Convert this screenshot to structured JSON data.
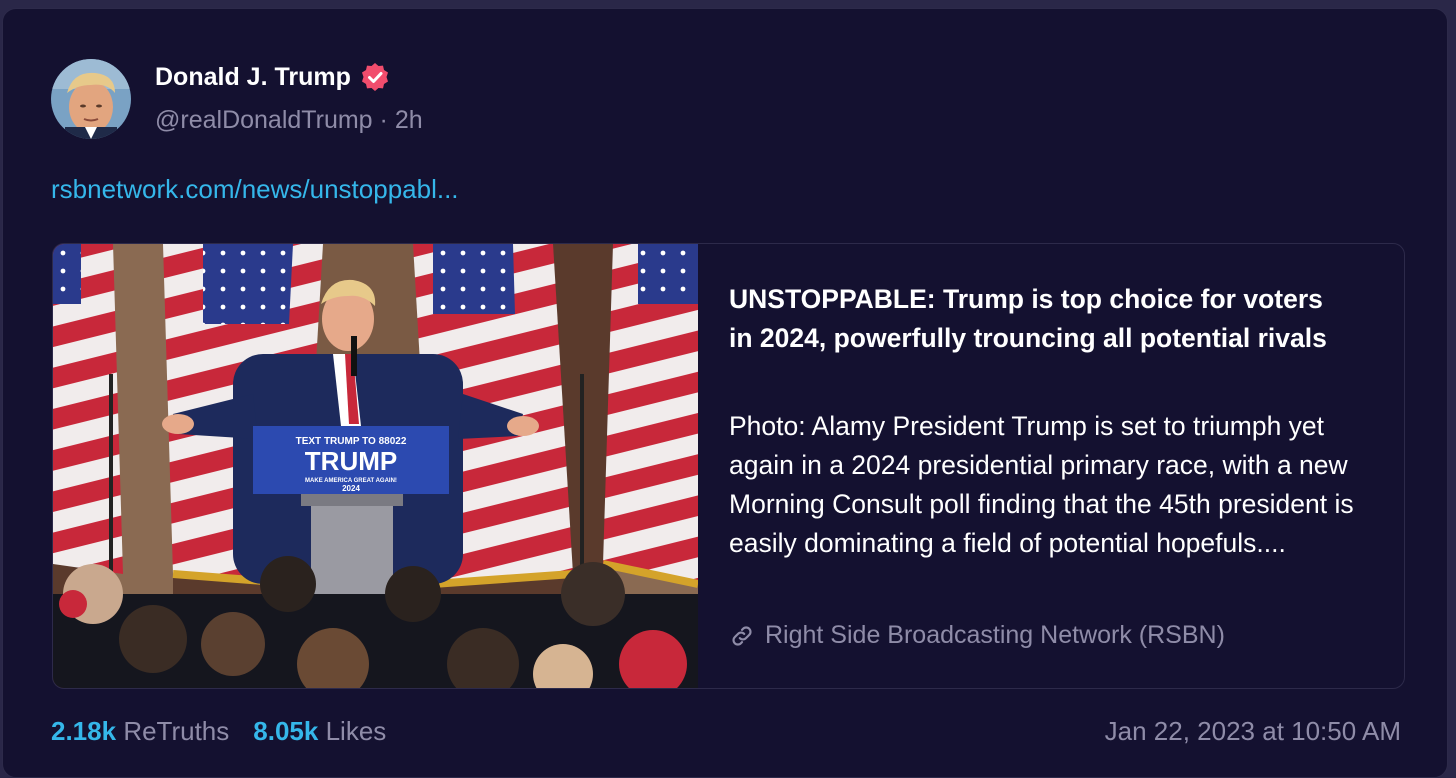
{
  "post": {
    "author": {
      "name": "Donald J. Trump",
      "handle": "@realDonaldTrump",
      "separator": "·",
      "time_ago": "2h"
    },
    "link_text": "rsbnetwork.com/news/unstoppabl...",
    "card": {
      "title": "UNSTOPPABLE: Trump is top choice for voters in 2024, powerfully trouncing all potential rivals",
      "description": "Photo: Alamy President Trump is set to triumph yet again in a 2024 presidential primary race, with a new Morning Consult poll finding that the 45th president is easily dominating a field of potential hopefuls....",
      "source": "Right Side Broadcasting Network (RSBN)",
      "image": {
        "podium_line1": "TEXT TRUMP TO 88022",
        "podium_name": "TRUMP",
        "podium_line3": "MAKE AMERICA GREAT AGAIN!",
        "podium_year": "2024"
      }
    },
    "stats": {
      "retruths_count": "2.18k",
      "retruths_label": "ReTruths",
      "likes_count": "8.05k",
      "likes_label": "Likes"
    },
    "timestamp": "Jan 22, 2023 at 10:50 AM"
  },
  "colors": {
    "background": "#141130",
    "link": "#35b7ea",
    "muted": "#8f8ca8",
    "verified": "#f14d6d"
  },
  "icons": {
    "verified": "verified-badge-icon",
    "link": "link-icon"
  }
}
